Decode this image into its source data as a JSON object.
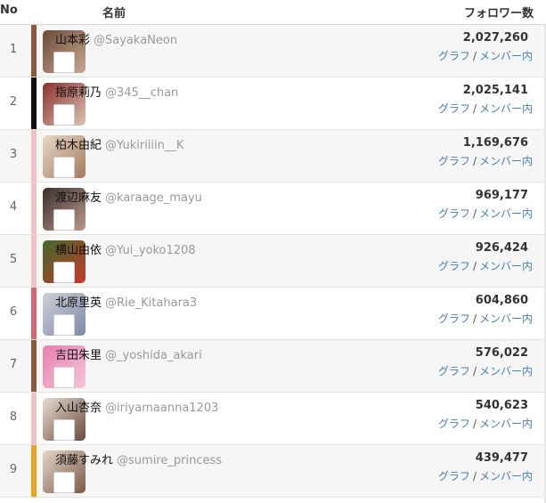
{
  "header": {
    "no": "No",
    "name": "名前",
    "followers": "フォロワー数"
  },
  "rows": [
    {
      "rank": "1",
      "name": "山本彩",
      "handle": "@SayakaNeon",
      "count": "2,027,260",
      "graph": "グラフ",
      "sep": "/",
      "members": "メンバー内",
      "bar_color": "#8a5a3c",
      "avatar_colors": [
        "#6b4a3a",
        "#c8a890"
      ]
    },
    {
      "rank": "2",
      "name": "指原莉乃",
      "handle": "@345__chan",
      "count": "2,025,141",
      "graph": "グラフ",
      "sep": "/",
      "members": "メンバー内",
      "bar_color": "#111111",
      "avatar_colors": [
        "#8c2f2f",
        "#d9c3b0"
      ]
    },
    {
      "rank": "3",
      "name": "柏木由紀",
      "handle": "@Yukiriiiin__K",
      "count": "1,169,676",
      "graph": "グラフ",
      "sep": "/",
      "members": "メンバー内",
      "bar_color": "#f1c0c8",
      "avatar_colors": [
        "#e7d9c8",
        "#a37a5a"
      ]
    },
    {
      "rank": "4",
      "name": "渡辺麻友",
      "handle": "@karaage_mayu",
      "count": "969,177",
      "graph": "グラフ",
      "sep": "/",
      "members": "メンバー内",
      "bar_color": "#f1c0c8",
      "avatar_colors": [
        "#3d2f2f",
        "#b89a8a"
      ]
    },
    {
      "rank": "5",
      "name": "横山由依",
      "handle": "@Yui_yoko1208",
      "count": "926,424",
      "graph": "グラフ",
      "sep": "/",
      "members": "メンバー内",
      "bar_color": "#f1c0c8",
      "avatar_colors": [
        "#3f6a2a",
        "#c43a2a"
      ]
    },
    {
      "rank": "6",
      "name": "北原里英",
      "handle": "@Rie_Kitahara3",
      "count": "604,860",
      "graph": "グラフ",
      "sep": "/",
      "members": "メンバー内",
      "bar_color": "#d9666e",
      "avatar_colors": [
        "#cfcfd6",
        "#7d8aa8"
      ]
    },
    {
      "rank": "7",
      "name": "吉田朱里",
      "handle": "@_yoshida_akari",
      "count": "576,022",
      "graph": "グラフ",
      "sep": "/",
      "members": "メンバー内",
      "bar_color": "#8a5a3c",
      "avatar_colors": [
        "#e87fb0",
        "#f4c6da"
      ]
    },
    {
      "rank": "8",
      "name": "入山杏奈",
      "handle": "@iriyamaanna1203",
      "count": "540,623",
      "graph": "グラフ",
      "sep": "/",
      "members": "メンバー内",
      "bar_color": "#f1c0c8",
      "avatar_colors": [
        "#e8dcd4",
        "#6a4a3e"
      ]
    },
    {
      "rank": "9",
      "name": "須藤すみれ",
      "handle": "@sumire_princess",
      "count": "439,477",
      "graph": "グラフ",
      "sep": "/",
      "members": "メンバー内",
      "bar_color": "#e8a41c",
      "avatar_colors": [
        "#e4d6c9",
        "#7a5a46"
      ]
    }
  ]
}
